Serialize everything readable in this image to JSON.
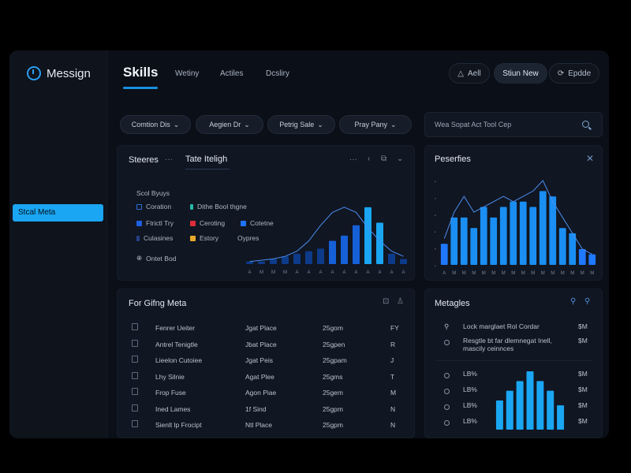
{
  "brand": {
    "name": "Messign"
  },
  "sidebar": {
    "items": [
      {
        "label": "Stcal Meta"
      }
    ]
  },
  "header": {
    "title": "Skills",
    "tabs": [
      "Wetiny",
      "Actiles",
      "Dcsliry"
    ],
    "actions": [
      {
        "label": "Aell"
      },
      {
        "label": "Stiun New"
      },
      {
        "label": "Epdde"
      }
    ]
  },
  "filters": [
    "Comtion Dis",
    "Aegien Dr",
    "Petrig Sale",
    "Pray Pany"
  ],
  "search": {
    "text": "Wea Sopat  Act Tool Cep"
  },
  "panel_skills": {
    "title": "Steeres",
    "tab": "Tate Iteligh",
    "legend_title": "Scol Byuys",
    "legend": [
      {
        "label": "Coration",
        "color": "#2f6fd8"
      },
      {
        "label": "Dithe Bool thgne",
        "color": "#25b7a8"
      },
      {
        "label": "Ftrictl Try",
        "color": "#1f5fe0"
      },
      {
        "label": "Ceroting",
        "color": "#e02d3a"
      },
      {
        "label": "Cotetne",
        "color": "#1e73ff"
      },
      {
        "label": "Culasines",
        "color": "#263f8a"
      },
      {
        "label": "Estory",
        "color": "#e8a92a"
      },
      {
        "label": "Oypres",
        "color": "#e6ecf4"
      }
    ],
    "footer": "Ontet Bod",
    "accent": "#1aa6f2"
  },
  "panel_perf": {
    "title": "Peserfies"
  },
  "panel_table": {
    "title": "For Gifng Meta",
    "rows": [
      {
        "name": "Fenrer Ueiter",
        "type": "Jgat Place",
        "time": "25gom",
        "code": "FY"
      },
      {
        "name": "Antrel Tenigtle",
        "type": "Jbat Place",
        "time": "25gpen",
        "code": "R"
      },
      {
        "name": "Lieelon Cutoiee",
        "type": "Jgat Peis",
        "time": "25gpam",
        "code": "J"
      },
      {
        "name": "Lhy Silnie",
        "type": "Agat Plee",
        "time": "25gms",
        "code": "T"
      },
      {
        "name": "Frop Fuse",
        "type": "Agon Piae",
        "time": "25gem",
        "code": "M"
      },
      {
        "name": "Ined Lames",
        "type": "1f Sind",
        "time": "25gpm",
        "code": "N"
      },
      {
        "name": "Sienlt lp Frocipt",
        "type": "Ntl Place",
        "time": "25gpm",
        "code": "N"
      }
    ]
  },
  "panel_metrics": {
    "title": "Metagles",
    "rows": [
      {
        "label": "Lock marglaet Rol Cordar",
        "value": "$M"
      },
      {
        "label": "Resgtle bt far dlemnegat Inell, mascily ceinnces",
        "value": "$M"
      },
      {
        "label": "LB%",
        "value": "$M"
      },
      {
        "label": "LB%",
        "value": "$M"
      },
      {
        "label": "LB%",
        "value": "$M"
      },
      {
        "label": "LB%",
        "value": "$M"
      }
    ]
  },
  "chart_data": [
    {
      "type": "bar",
      "x": [
        "A",
        "M",
        "M",
        "M",
        "A",
        "A",
        "A",
        "A",
        "A",
        "A",
        "A",
        "A",
        "A",
        "A"
      ],
      "values": [
        1,
        1,
        2,
        3,
        4,
        5,
        6,
        9,
        11,
        15,
        22,
        16,
        4,
        2
      ],
      "line": [
        1,
        1.5,
        2,
        3,
        5,
        9,
        15,
        20,
        22,
        20,
        14,
        9,
        5,
        3
      ],
      "ylim": [
        0,
        25
      ],
      "colors": [
        "#0d3b8a",
        "#1660d8",
        "#1aa6f2"
      ]
    },
    {
      "type": "bar",
      "x": [
        "A",
        "M",
        "M",
        "M",
        "M",
        "M",
        "M",
        "M",
        "M",
        "M",
        "M",
        "M",
        "M",
        "M",
        "M",
        "M",
        "M"
      ],
      "values": [
        4,
        9,
        9,
        7,
        11,
        9,
        11,
        12,
        12,
        11,
        14,
        13,
        7,
        6,
        3,
        2
      ],
      "line": [
        5,
        10,
        13,
        10,
        11,
        12,
        13,
        12,
        13,
        14,
        16,
        12,
        9,
        6,
        3,
        2
      ],
      "ylim": [
        0,
        16
      ],
      "colors": [
        "#1f78ff",
        "#1a8ef2"
      ]
    },
    {
      "type": "bar",
      "values": [
        6,
        8,
        10,
        12,
        10,
        8,
        5
      ],
      "ylim": [
        0,
        12
      ],
      "colors": [
        "#1660d8",
        "#1aa6f2"
      ]
    }
  ]
}
